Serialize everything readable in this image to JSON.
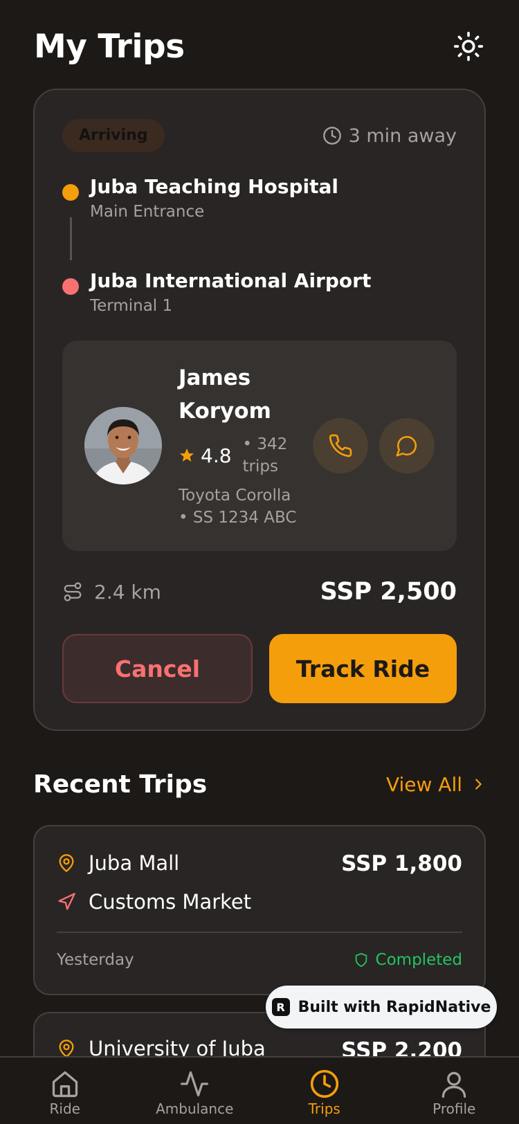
{
  "header": {
    "title": "My Trips",
    "theme_icon": "sun-icon"
  },
  "active_trip": {
    "status": "Arriving",
    "eta": "3 min away",
    "pickup": {
      "name": "Juba Teaching Hospital",
      "detail": "Main Entrance",
      "color": "#f59e0b"
    },
    "dropoff": {
      "name": "Juba International Airport",
      "detail": "Terminal 1",
      "color": "#f87171"
    },
    "driver": {
      "name": "James Koryom",
      "rating": "4.8",
      "trips": "• 342 trips",
      "vehicle": "Toyota Corolla • SS 1234 ABC"
    },
    "distance": "2.4 km",
    "fare": "SSP 2,500",
    "cancel_label": "Cancel",
    "track_label": "Track Ride"
  },
  "recent": {
    "title": "Recent Trips",
    "view_all": "View All",
    "trips": [
      {
        "from": "Juba Mall",
        "to": "Customs Market",
        "fare": "SSP 1,800",
        "date": "Yesterday",
        "status": "Completed"
      },
      {
        "from": "University of Juba",
        "fare": "SSP 2,200"
      }
    ]
  },
  "badge": {
    "label": "Built with RapidNative"
  },
  "tabs": [
    {
      "label": "Ride",
      "icon": "home-icon"
    },
    {
      "label": "Ambulance",
      "icon": "activity-icon"
    },
    {
      "label": "Trips",
      "icon": "clock-icon",
      "active": true
    },
    {
      "label": "Profile",
      "icon": "user-icon"
    }
  ],
  "colors": {
    "accent": "#f59e0b",
    "danger": "#f87171",
    "success": "#22c55e",
    "background": "#1c1917",
    "card": "#292524"
  }
}
